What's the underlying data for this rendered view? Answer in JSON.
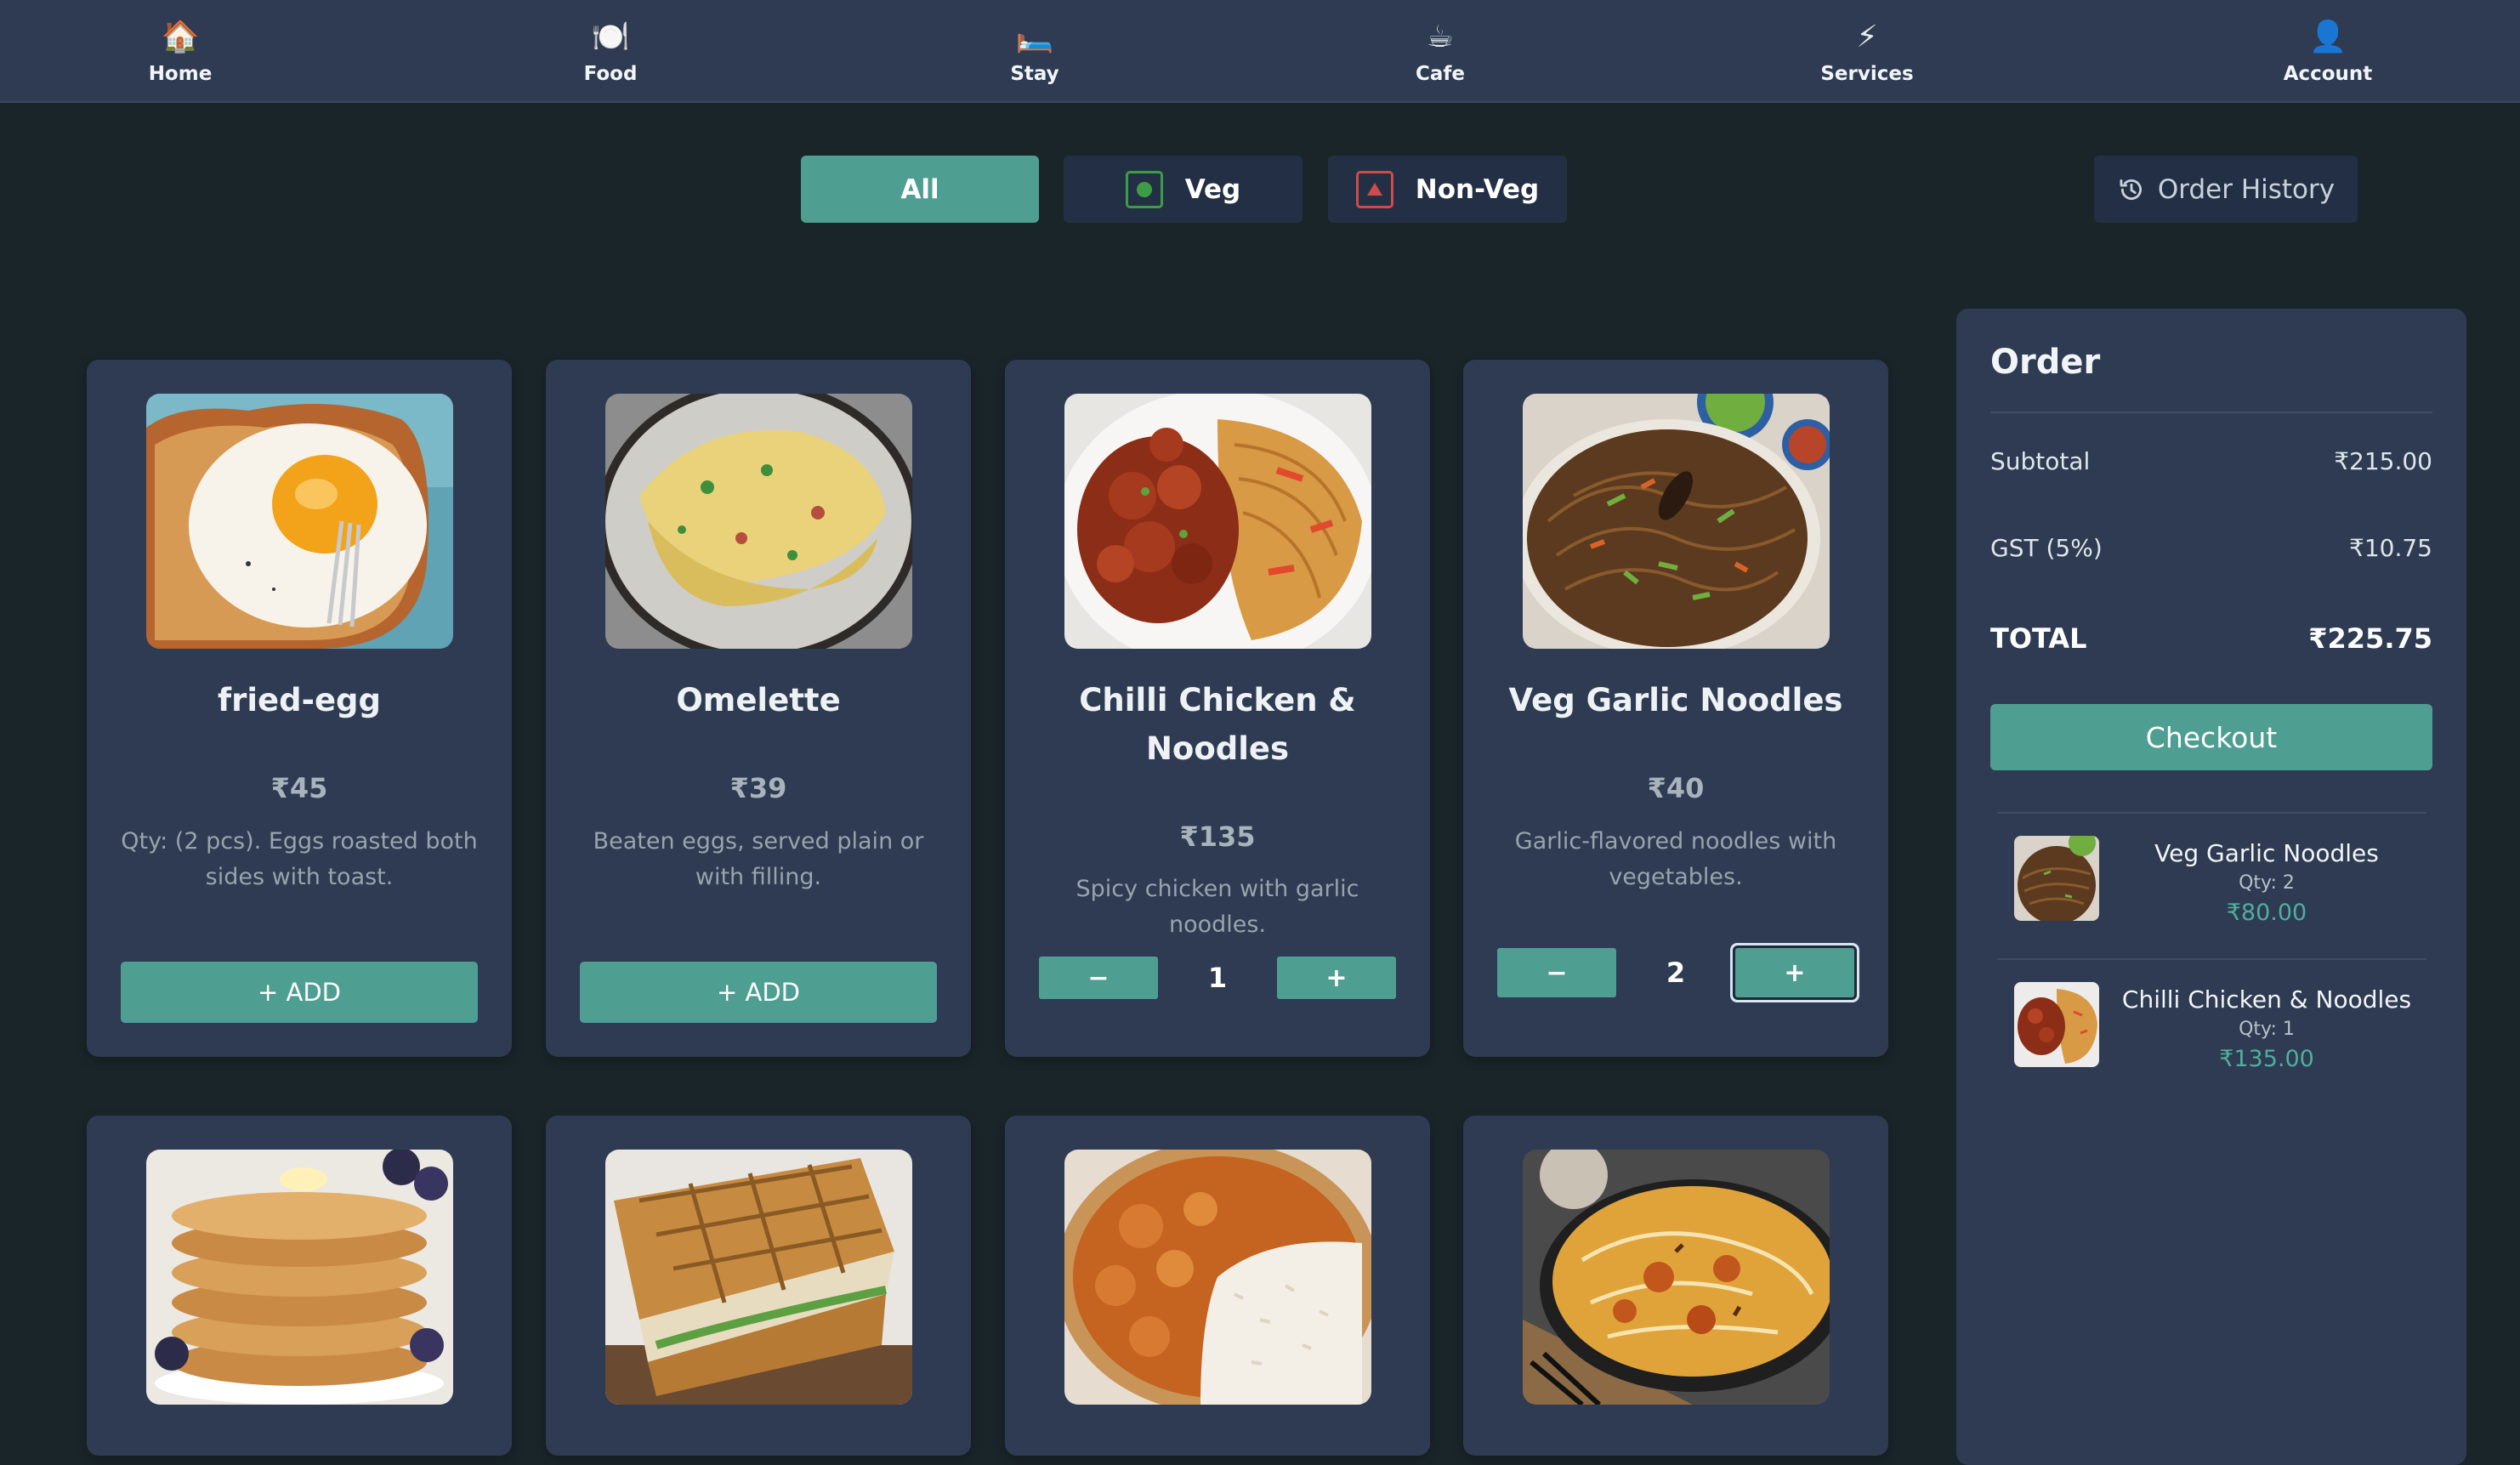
{
  "nav": {
    "items": [
      {
        "label": "Home",
        "icon": "🏠"
      },
      {
        "label": "Food",
        "icon": "🍽️"
      },
      {
        "label": "Stay",
        "icon": "🛏️"
      },
      {
        "label": "Cafe",
        "icon": "☕"
      },
      {
        "label": "Services",
        "icon": "⚡"
      },
      {
        "label": "Account",
        "icon": "👤"
      }
    ]
  },
  "filters": {
    "all": "All",
    "veg": "Veg",
    "non_veg": "Non-Veg",
    "active": "All"
  },
  "order_history_label": "Order History",
  "menu": {
    "items": [
      {
        "name": "fried-egg",
        "price": "₹45",
        "desc": "Qty: (2 pcs). Eggs roasted both sides with toast.",
        "action": "+ ADD"
      },
      {
        "name": "Omelette",
        "price": "₹39",
        "desc": "Beaten eggs, served plain or with filling.",
        "action": "+ ADD"
      },
      {
        "name": "Chilli Chicken & Noodles",
        "price": "₹135",
        "desc": "Spicy chicken with garlic noodles.",
        "qty": "1",
        "minus": "−",
        "plus": "+"
      },
      {
        "name": "Veg Garlic Noodles",
        "price": "₹40",
        "desc": "Garlic-flavored noodles with vegetables.",
        "qty": "2",
        "minus": "−",
        "plus": "+"
      }
    ]
  },
  "order": {
    "title": "Order",
    "subtotal_label": "Subtotal",
    "subtotal": "₹215.00",
    "gst_label": "GST (5%)",
    "gst": "₹10.75",
    "total_label": "TOTAL",
    "total": "₹225.75",
    "checkout_label": "Checkout",
    "items": [
      {
        "name": "Veg Garlic Noodles",
        "qty": "Qty: 2",
        "price": "₹80.00"
      },
      {
        "name": "Chilli Chicken & Noodles",
        "qty": "Qty: 1",
        "price": "₹135.00"
      }
    ]
  },
  "colors": {
    "background": "#1a2529",
    "panel": "#2e3b52",
    "accent": "#4f9e92",
    "veg": "#3f9c46",
    "non_veg": "#d14a4a"
  }
}
